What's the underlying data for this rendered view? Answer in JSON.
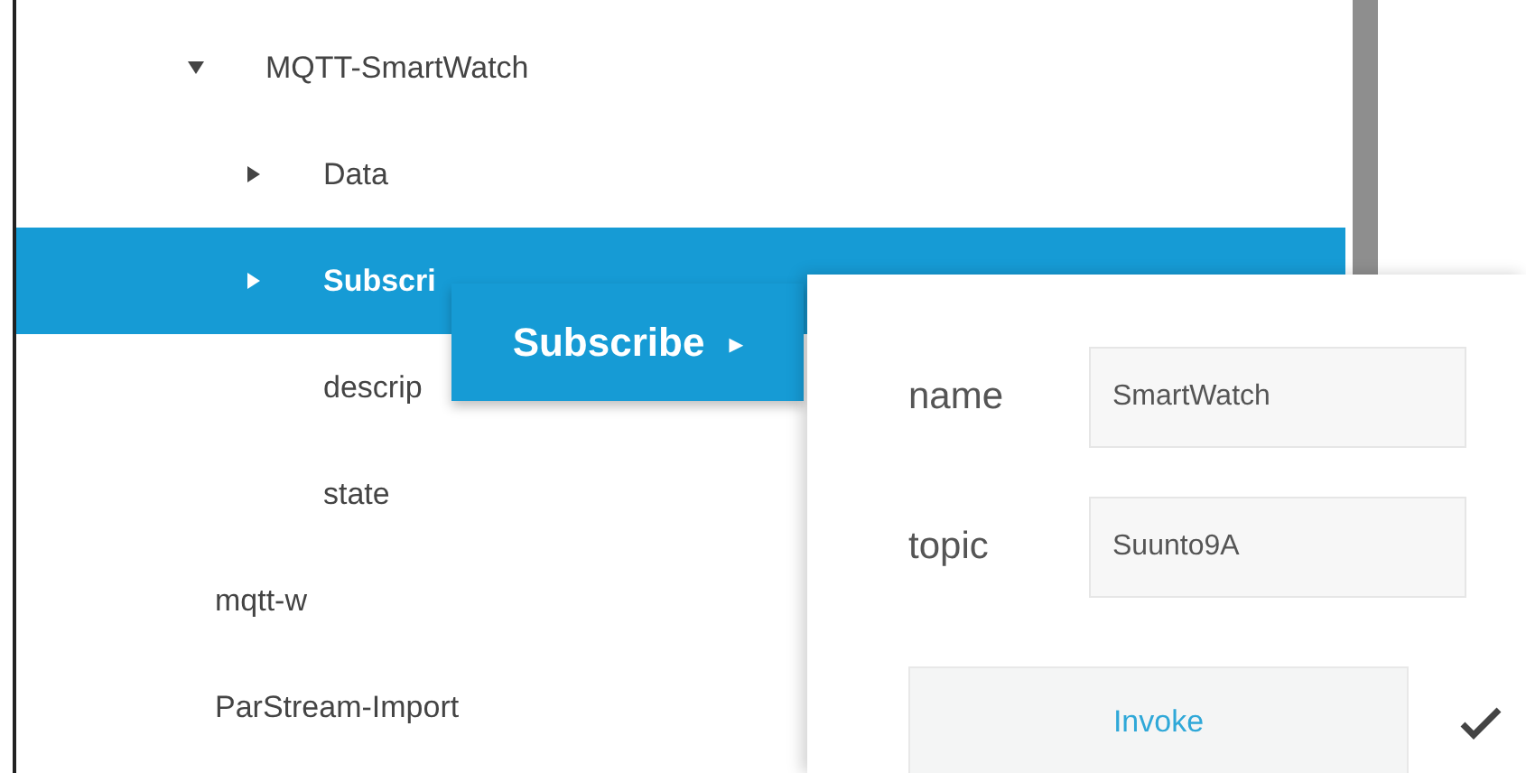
{
  "tree": [
    {
      "kind": "branch",
      "label": "MQTT-SmartWatch",
      "expanded": true,
      "selected": false,
      "children": [
        {
          "kind": "branch",
          "label": "Data",
          "expanded": false,
          "selected": false
        },
        {
          "kind": "branch",
          "label": "Subscri",
          "expanded": false,
          "selected": true
        },
        {
          "kind": "leaf",
          "label": "descrip",
          "selected": false
        },
        {
          "kind": "leaf",
          "label": "state",
          "selected": false
        }
      ]
    },
    {
      "kind": "leaf",
      "label": "mqtt-w",
      "selected": false
    },
    {
      "kind": "leaf",
      "label": "ParStream-Import",
      "selected": false
    }
  ],
  "menu": {
    "label": "Subscribe",
    "arrow": "▸"
  },
  "dialog": {
    "fields": [
      {
        "label": "name",
        "value": "SmartWatch"
      },
      {
        "label": "topic",
        "value": "Suunto9A"
      }
    ],
    "button": "Invoke",
    "done": true
  }
}
